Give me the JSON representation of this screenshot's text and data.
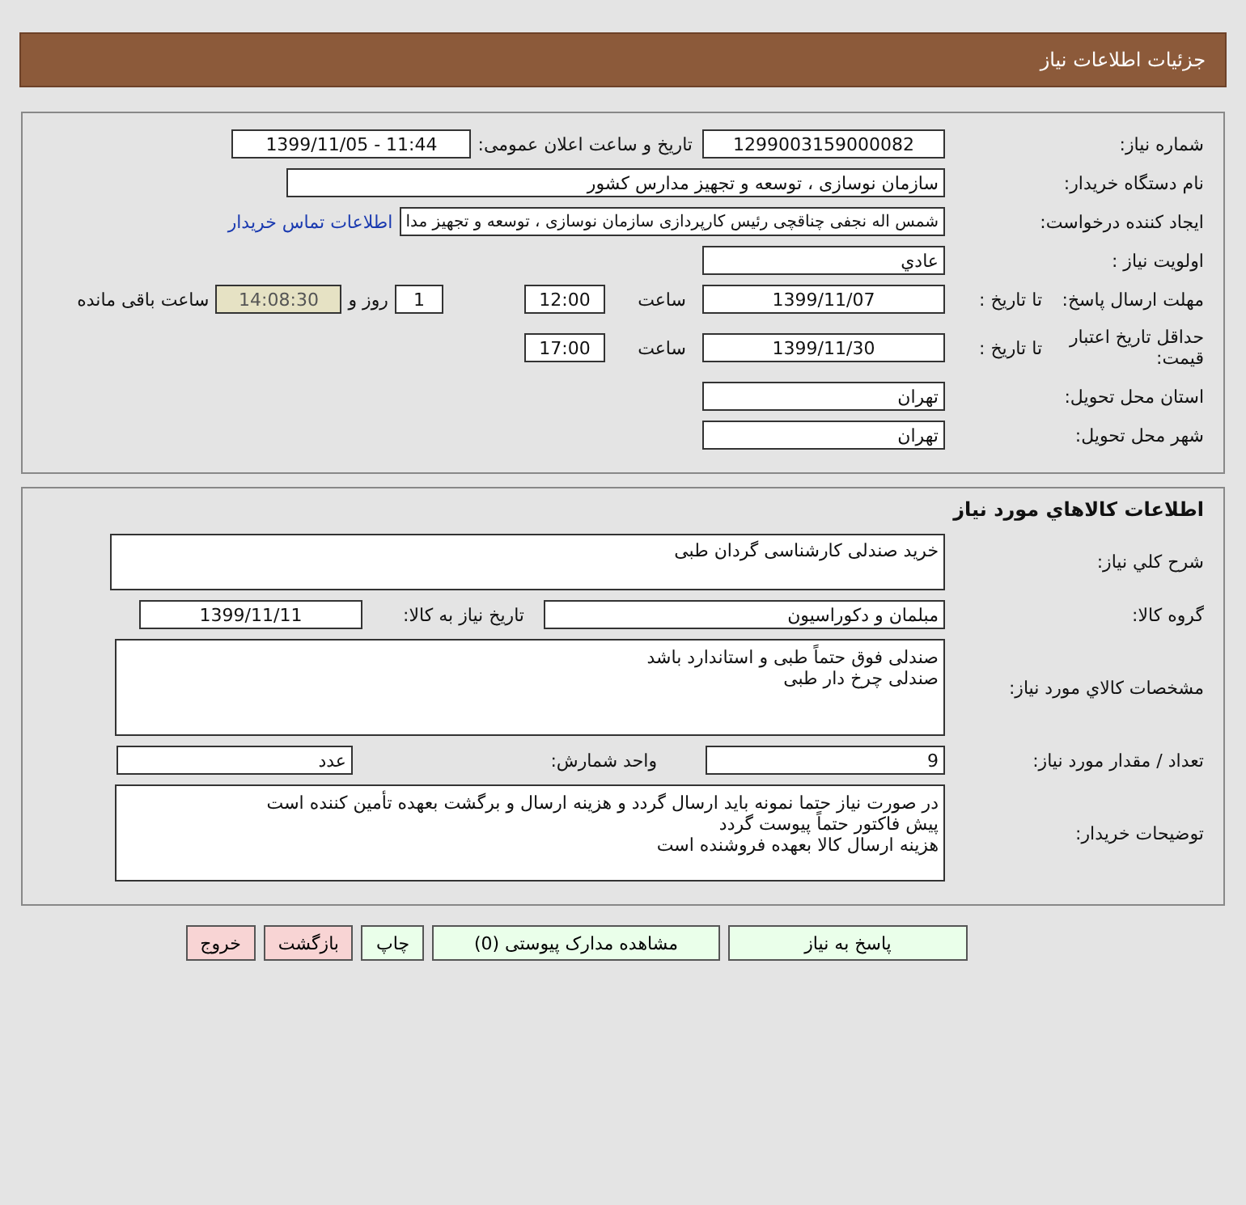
{
  "header": {
    "title": "جزئیات اطلاعات نیاز"
  },
  "need": {
    "need_number": {
      "label": "شماره نیاز:",
      "value": "1299003159000082"
    },
    "announce": {
      "label": "تاریخ و ساعت اعلان عمومی:",
      "value": "1399/11/05 - 11:44"
    },
    "buyer": {
      "label": "نام دستگاه خریدار:",
      "value": "سازمان نوسازی ، توسعه و تجهیز مدارس کشور"
    },
    "creator": {
      "label": "ایجاد کننده درخواست:",
      "value": "شمس اله نجفی چناقچی رئیس کارپردازی سازمان نوسازی ، توسعه و تجهیز مدا",
      "link": "اطلاعات تماس خریدار"
    },
    "priority": {
      "label": "اولویت نیاز :",
      "value": "عادي"
    },
    "deadline": {
      "label": "مهلت ارسال پاسخ:",
      "to_date_label": "تا تاریخ :",
      "date": "1399/11/07",
      "time_label": "ساعت",
      "time": "12:00",
      "days": "1",
      "days_label": "روز و",
      "remaining": "14:08:30",
      "remaining_label": "ساعت باقی مانده"
    },
    "validity": {
      "label": "حداقل تاریخ اعتبار قیمت:",
      "to_date_label": "تا تاریخ :",
      "date": "1399/11/30",
      "time_label": "ساعت",
      "time": "17:00"
    },
    "province": {
      "label": "استان محل تحویل:",
      "value": "تهران"
    },
    "city": {
      "label": "شهر محل تحویل:",
      "value": "تهران"
    }
  },
  "goods": {
    "title": "اطلاعات کالاهاي مورد نياز",
    "description": {
      "label": "شرح کلي نياز:",
      "value": "خرید صندلی کارشناسی گردان طبی"
    },
    "group": {
      "label": "گروه کالا:",
      "value": "مبلمان و دکوراسیون"
    },
    "need_date": {
      "label": "تاریخ نیاز به کالا:",
      "value": "1399/11/11"
    },
    "specs": {
      "label": "مشخصات کالاي مورد نياز:",
      "lines": [
        "صندلی فوق حتماً طبی و استاندارد باشد",
        "صندلی چرخ دار طبی"
      ]
    },
    "quantity": {
      "label": "تعداد / مقدار مورد نیاز:",
      "value": "9"
    },
    "unit": {
      "label": "واحد شمارش:",
      "value": "عدد"
    },
    "notes": {
      "label": "توضیحات خریدار:",
      "lines": [
        "در صورت نیاز حتما نمونه باید ارسال گردد و هزینه ارسال و برگشت بعهده تأمین کننده است",
        "پیش فاکتور حتماً پیوست گردد",
        "هزینه ارسال کالا بعهده فروشنده است"
      ]
    }
  },
  "buttons": [
    {
      "label": "پاسخ به نیاز",
      "kind": "primary"
    },
    {
      "label": "مشاهده مدارک پیوستی (0)",
      "kind": "primary"
    },
    {
      "label": "چاپ",
      "kind": "primary"
    },
    {
      "label": "بازگشت",
      "kind": "danger"
    },
    {
      "label": "خروج",
      "kind": "danger"
    }
  ]
}
